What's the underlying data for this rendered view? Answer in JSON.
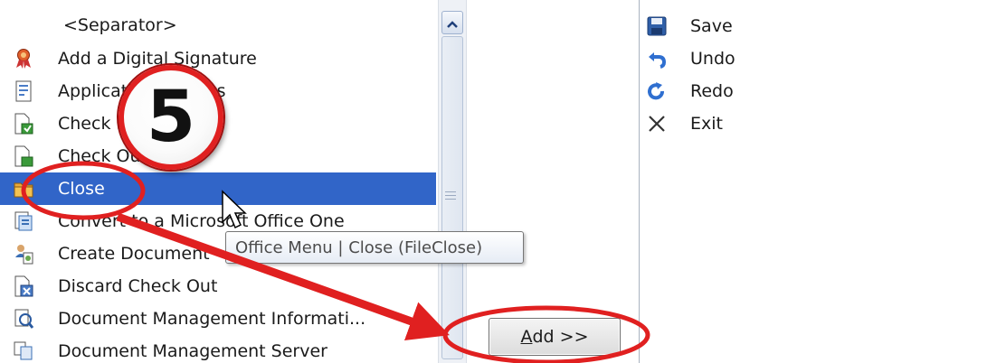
{
  "commands": [
    {
      "label": "<Separator>",
      "icon": "separator"
    },
    {
      "label": "Add a Digital Signature",
      "icon": "ribbon-award-icon"
    },
    {
      "label": "Application Options",
      "icon": "options-document-icon"
    },
    {
      "label": "Check In",
      "icon": "check-in-icon"
    },
    {
      "label": "Check Out",
      "icon": "check-out-icon"
    },
    {
      "label": "Close",
      "icon": "folder-close-icon"
    },
    {
      "label": "Convert to a Microsoft Office One",
      "icon": "convert-icon"
    },
    {
      "label": "Create Document",
      "icon": "create-document-icon"
    },
    {
      "label": "Discard Check Out",
      "icon": "discard-check-out-icon"
    },
    {
      "label": "Document Management Informati...",
      "icon": "document-management-info-icon"
    },
    {
      "label": "Document Management Server",
      "icon": "document-management-server-icon"
    }
  ],
  "selected_index": 5,
  "toolbar_items": [
    {
      "label": "Save",
      "icon": "save-icon"
    },
    {
      "label": "Undo",
      "icon": "undo-icon"
    },
    {
      "label": "Redo",
      "icon": "redo-icon"
    },
    {
      "label": "Exit",
      "icon": "close-x-icon"
    }
  ],
  "add_button": {
    "accel": "A",
    "rest": "dd >>"
  },
  "tooltip": "Office Menu | Close (FileClose)",
  "step_number": "5",
  "colors": {
    "selection": "#3165c8",
    "annotation": "#e02020"
  }
}
